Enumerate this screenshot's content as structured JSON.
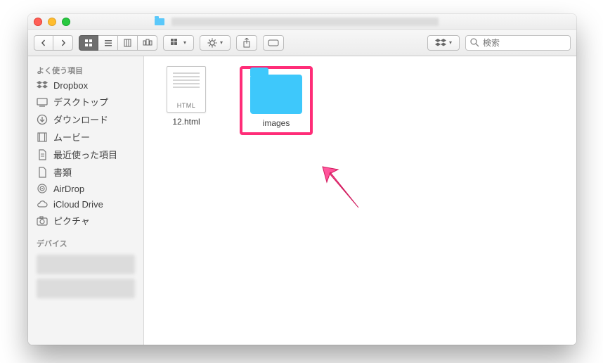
{
  "traffic": {
    "close": "close",
    "minimize": "minimize",
    "zoom": "zoom"
  },
  "toolbar": {
    "nav_back": "‹",
    "nav_fwd": "›",
    "view_icon_tip": "icon view",
    "view_list_tip": "list view",
    "view_column_tip": "column view",
    "view_cover_tip": "cover flow",
    "arrange_label": "",
    "action_label": "",
    "share_label": "",
    "tags_label": "",
    "dropbox_label": ""
  },
  "search": {
    "placeholder": "検索"
  },
  "sidebar": {
    "favorites_header": "よく使う項目",
    "items": [
      {
        "label": "Dropbox"
      },
      {
        "label": "デスクトップ"
      },
      {
        "label": "ダウンロード"
      },
      {
        "label": "ムービー"
      },
      {
        "label": "最近使った項目"
      },
      {
        "label": "書類"
      },
      {
        "label": "AirDrop"
      },
      {
        "label": "iCloud Drive"
      },
      {
        "label": "ピクチャ"
      }
    ],
    "devices_header": "デバイス"
  },
  "files": [
    {
      "name": "12.html",
      "kind": "html"
    },
    {
      "name": "images",
      "kind": "folder",
      "highlighted": true
    }
  ],
  "annotation": {
    "arrow": "pointer-arrow"
  }
}
